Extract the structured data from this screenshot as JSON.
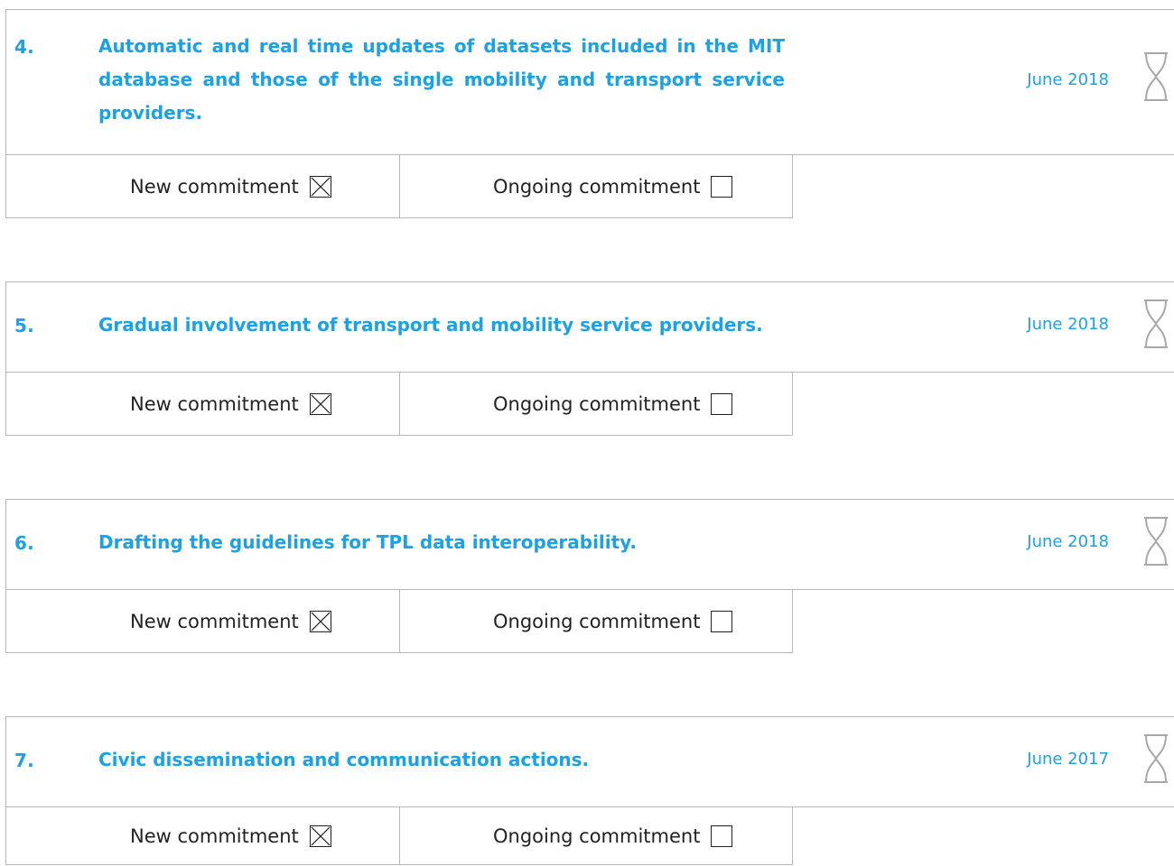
{
  "commitments": [
    {
      "number": "4.",
      "title": "Automatic and real time updates of datasets included in the MIT database and those of the single mobility and transport service providers.",
      "date": "June 2018",
      "status_icon": "hourglass-icon",
      "new_label": "New commitment",
      "new_checked": true,
      "ongoing_label": "Ongoing commitment",
      "ongoing_checked": false
    },
    {
      "number": "5.",
      "title": "Gradual involvement of transport and mobility service providers.",
      "date": "June 2018",
      "status_icon": "hourglass-icon",
      "new_label": "New commitment",
      "new_checked": true,
      "ongoing_label": "Ongoing commitment",
      "ongoing_checked": false
    },
    {
      "number": "6.",
      "title": "Drafting the guidelines for TPL data interoperability.",
      "date": "June 2018",
      "status_icon": "hourglass-icon",
      "new_label": "New commitment",
      "new_checked": true,
      "ongoing_label": "Ongoing commitment",
      "ongoing_checked": false
    },
    {
      "number": "7.",
      "title": "Civic dissemination and communication actions.",
      "date": "June 2017",
      "status_icon": "hourglass-icon",
      "new_label": "New commitment",
      "new_checked": true,
      "ongoing_label": "Ongoing commitment",
      "ongoing_checked": false
    }
  ],
  "colors": {
    "accent": "#1aa1e6",
    "border": "#b8b8b8",
    "text": "#222222"
  }
}
